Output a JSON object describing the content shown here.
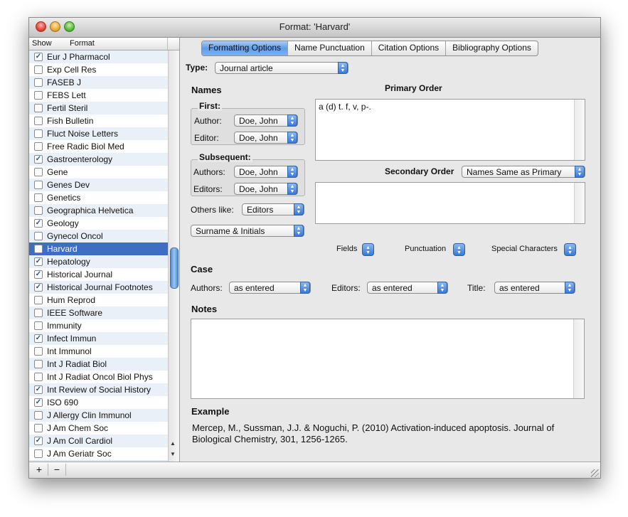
{
  "window": {
    "title": "Format: 'Harvard'"
  },
  "sidebar": {
    "columns": {
      "show": "Show",
      "format": "Format"
    },
    "items": [
      {
        "label": "Eur J Pharmacol",
        "checked": true
      },
      {
        "label": "Exp Cell Res",
        "checked": false
      },
      {
        "label": "FASEB J",
        "checked": false
      },
      {
        "label": "FEBS Lett",
        "checked": false
      },
      {
        "label": "Fertil Steril",
        "checked": false
      },
      {
        "label": "Fish Bulletin",
        "checked": false
      },
      {
        "label": "Fluct Noise Letters",
        "checked": false
      },
      {
        "label": "Free Radic Biol Med",
        "checked": false
      },
      {
        "label": "Gastroenterology",
        "checked": true
      },
      {
        "label": "Gene",
        "checked": false
      },
      {
        "label": "Genes Dev",
        "checked": false
      },
      {
        "label": "Genetics",
        "checked": false
      },
      {
        "label": "Geographica Helvetica",
        "checked": false
      },
      {
        "label": "Geology",
        "checked": true
      },
      {
        "label": "Gynecol Oncol",
        "checked": false
      },
      {
        "label": "Harvard",
        "checked": false,
        "selected": true
      },
      {
        "label": "Hepatology",
        "checked": true
      },
      {
        "label": "Historical Journal",
        "checked": true
      },
      {
        "label": "Historical Journal Footnotes",
        "checked": true
      },
      {
        "label": "Hum Reprod",
        "checked": false
      },
      {
        "label": "IEEE Software",
        "checked": false
      },
      {
        "label": "Immunity",
        "checked": false
      },
      {
        "label": "Infect Immun",
        "checked": true
      },
      {
        "label": "Int Immunol",
        "checked": false
      },
      {
        "label": "Int J Radiat Biol",
        "checked": false
      },
      {
        "label": "Int J Radiat Oncol Biol Phys",
        "checked": false
      },
      {
        "label": "Int Review of Social History",
        "checked": true
      },
      {
        "label": "ISO 690",
        "checked": true
      },
      {
        "label": "J Allergy Clin Immunol",
        "checked": false
      },
      {
        "label": "J Am Chem Soc",
        "checked": false
      },
      {
        "label": "J Am Coll Cardiol",
        "checked": true
      },
      {
        "label": "J Am Geriatr Soc",
        "checked": false
      }
    ],
    "footer": {
      "add": "+",
      "remove": "−"
    }
  },
  "tabs": [
    {
      "label": "Formatting Options",
      "active": true
    },
    {
      "label": "Name Punctuation",
      "active": false
    },
    {
      "label": "Citation Options",
      "active": false
    },
    {
      "label": "Bibliography Options",
      "active": false
    }
  ],
  "form": {
    "type_label": "Type:",
    "type_value": "Journal article",
    "names_heading": "Names",
    "first_heading": "First:",
    "author_label": "Author:",
    "author_value": "Doe, John",
    "editor_label": "Editor:",
    "editor_value": "Doe, John",
    "subsequent_heading": "Subsequent:",
    "authors_label": "Authors:",
    "authors_value": "Doe, John",
    "editors_label": "Editors:",
    "editors_value": "Doe, John",
    "others_label": "Others like:",
    "others_value": "Editors",
    "name_format_value": "Surname & Initials",
    "primary_order_heading": "Primary Order",
    "primary_order_text": "a (d) t. f, v, p-.",
    "secondary_order_heading": "Secondary Order",
    "secondary_order_value": "Names Same as Primary",
    "fields_label": "Fields",
    "punctuation_label": "Punctuation",
    "special_chars_label": "Special Characters",
    "case_heading": "Case",
    "case_authors_label": "Authors:",
    "case_authors_value": "as entered",
    "case_editors_label": "Editors:",
    "case_editors_value": "as entered",
    "case_title_label": "Title:",
    "case_title_value": "as entered",
    "notes_heading": "Notes",
    "example_heading": "Example",
    "example_text": "Mercep, M., Sussman, J.J. & Noguchi, P. (2010) Activation-induced apoptosis. Journal of Biological Chemistry, 301, 1256-1265."
  }
}
